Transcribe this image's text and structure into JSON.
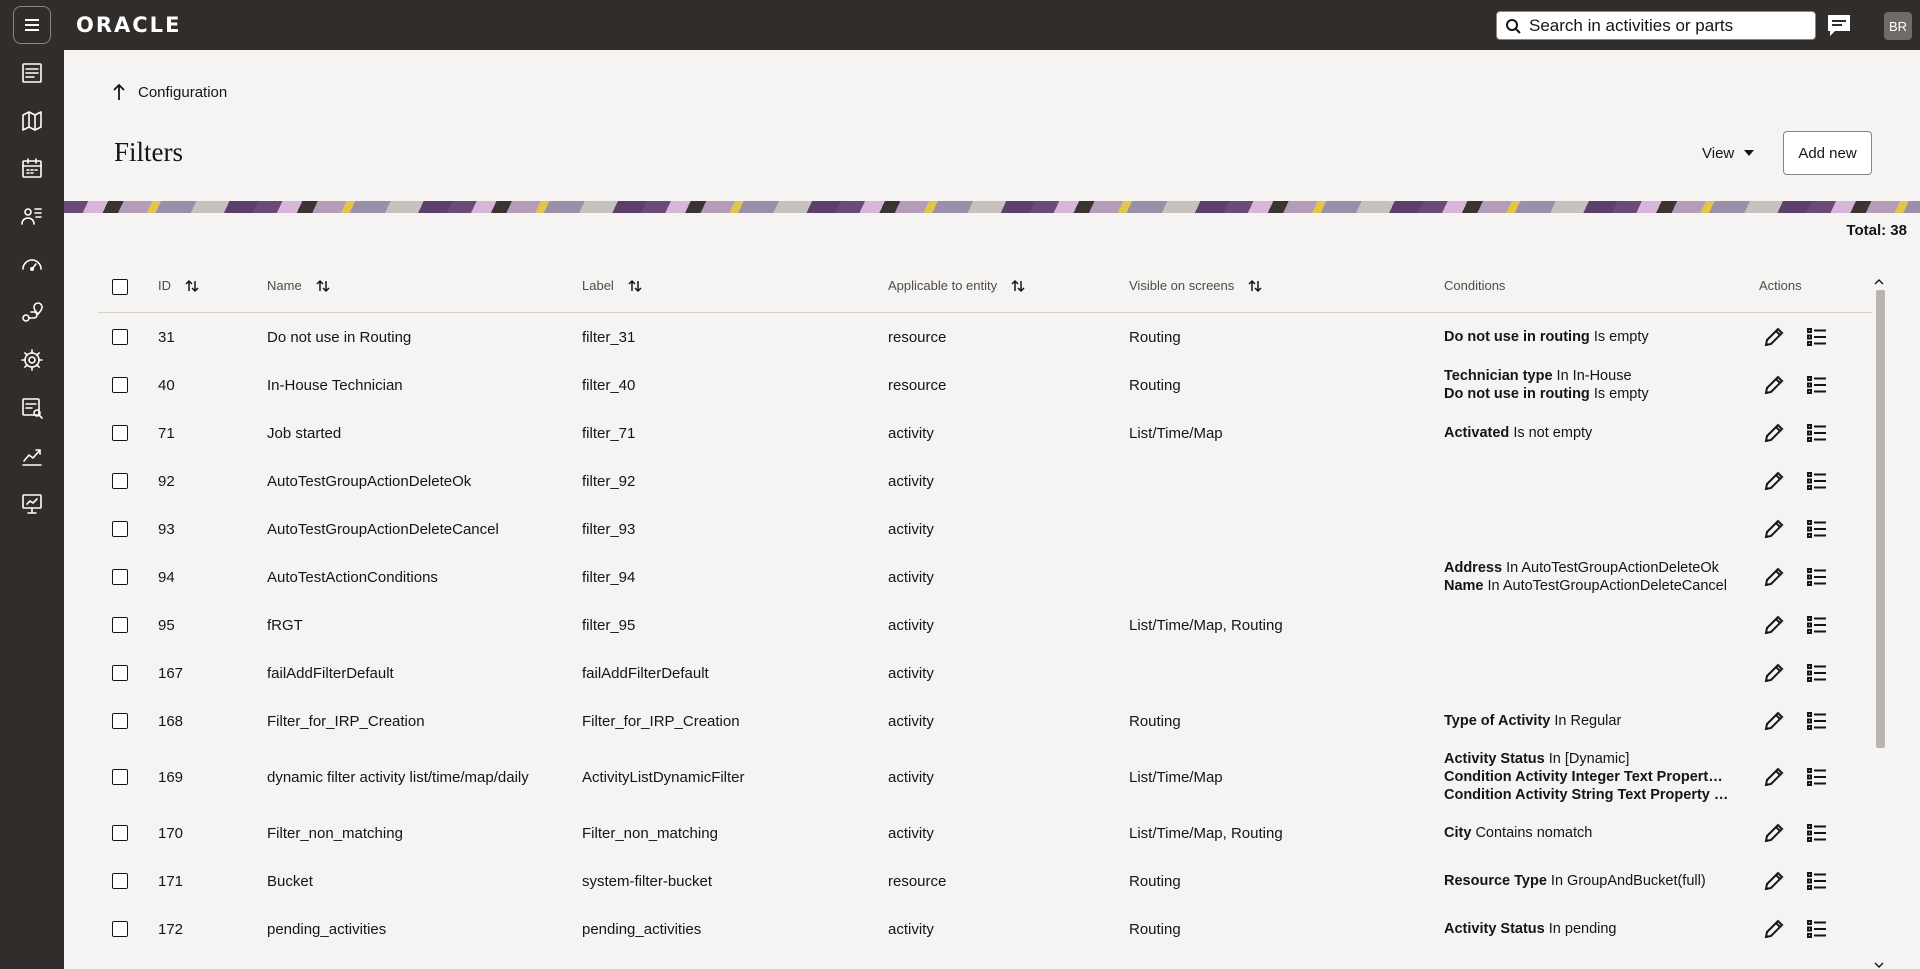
{
  "app": {
    "logo": "ORACLE",
    "search_placeholder": "Search in activities or parts",
    "avatar_initials": "BR"
  },
  "sidebar": {
    "icons": [
      "dashboard-icon",
      "map-icon",
      "calendar-icon",
      "people-icon",
      "gauge-icon",
      "route-icon",
      "gear-icon",
      "report-icon",
      "analytics-icon",
      "presentation-icon"
    ]
  },
  "breadcrumb": {
    "label": "Configuration"
  },
  "page": {
    "title": "Filters",
    "view_label": "View",
    "add_label": "Add new",
    "total": "Total: 38"
  },
  "table": {
    "headers": {
      "id": "ID",
      "name": "Name",
      "label": "Label",
      "entity": "Applicable to entity",
      "screens": "Visible on screens",
      "conditions": "Conditions",
      "actions": "Actions"
    },
    "rows": [
      {
        "id": "31",
        "name": "Do not use in Routing",
        "label": "filter_31",
        "entity": "resource",
        "screens": "Routing",
        "conditions": [
          {
            "field": "Do not use in routing",
            "op": "Is empty"
          }
        ]
      },
      {
        "id": "40",
        "name": "In-House Technician",
        "label": "filter_40",
        "entity": "resource",
        "screens": "Routing",
        "conditions": [
          {
            "field": "Technician type",
            "op": "In In-House"
          },
          {
            "field": "Do not use in routing",
            "op": "Is empty"
          }
        ]
      },
      {
        "id": "71",
        "name": "Job started",
        "label": "filter_71",
        "entity": "activity",
        "screens": "List/Time/Map",
        "conditions": [
          {
            "field": "Activated",
            "op": "Is not empty"
          }
        ]
      },
      {
        "id": "92",
        "name": "AutoTestGroupActionDeleteOk",
        "label": "filter_92",
        "entity": "activity",
        "screens": "",
        "conditions": []
      },
      {
        "id": "93",
        "name": "AutoTestGroupActionDeleteCancel",
        "label": "filter_93",
        "entity": "activity",
        "screens": "",
        "conditions": []
      },
      {
        "id": "94",
        "name": "AutoTestActionConditions",
        "label": "filter_94",
        "entity": "activity",
        "screens": "",
        "conditions": [
          {
            "field": "Address",
            "op": "In AutoTestGroupActionDeleteOk"
          },
          {
            "field": "Name",
            "op": "In AutoTestGroupActionDeleteCancel"
          }
        ]
      },
      {
        "id": "95",
        "name": "fRGT",
        "label": "filter_95",
        "entity": "activity",
        "screens": "List/Time/Map, Routing",
        "conditions": []
      },
      {
        "id": "167",
        "name": "failAddFilterDefault",
        "label": "failAddFilterDefault",
        "entity": "activity",
        "screens": "",
        "conditions": []
      },
      {
        "id": "168",
        "name": "Filter_for_IRP_Creation",
        "label": "Filter_for_IRP_Creation",
        "entity": "activity",
        "screens": "Routing",
        "conditions": [
          {
            "field": "Type of Activity",
            "op": "In Regular"
          }
        ]
      },
      {
        "id": "169",
        "name": "dynamic filter activity list/time/map/daily",
        "label": "ActivityListDynamicFilter",
        "entity": "activity",
        "screens": "List/Time/Map",
        "conditions": [
          {
            "field": "Activity Status",
            "op": "In [Dynamic]"
          },
          {
            "field": "Condition Activity Integer Text Propert…",
            "op": ""
          },
          {
            "field": "Condition Activity String Text Property …",
            "op": ""
          }
        ]
      },
      {
        "id": "170",
        "name": "Filter_non_matching",
        "label": "Filter_non_matching",
        "entity": "activity",
        "screens": "List/Time/Map, Routing",
        "conditions": [
          {
            "field": "City",
            "op": "Contains nomatch"
          }
        ]
      },
      {
        "id": "171",
        "name": "Bucket",
        "label": "system-filter-bucket",
        "entity": "resource",
        "screens": "Routing",
        "conditions": [
          {
            "field": "Resource Type",
            "op": "In GroupAndBucket(full)"
          }
        ]
      },
      {
        "id": "172",
        "name": "pending_activities",
        "label": "pending_activities",
        "entity": "activity",
        "screens": "Routing",
        "conditions": [
          {
            "field": "Activity Status",
            "op": "In pending"
          }
        ]
      }
    ]
  }
}
